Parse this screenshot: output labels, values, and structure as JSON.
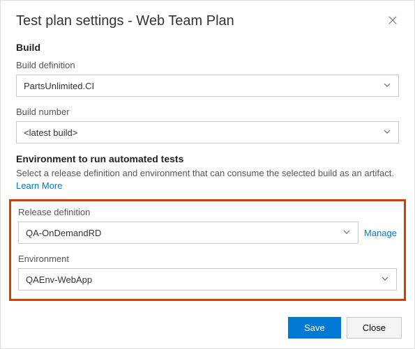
{
  "dialog": {
    "title": "Test plan settings - Web Team Plan"
  },
  "build": {
    "heading": "Build",
    "definition_label": "Build definition",
    "definition_value": "PartsUnlimited.CI",
    "number_label": "Build number",
    "number_value": "<latest build>"
  },
  "env": {
    "heading": "Environment to run automated tests",
    "description": "Select a release definition and environment that can consume the selected build as an artifact. ",
    "learn_more": "Learn More",
    "release_label": "Release definition",
    "release_value": "QA-OnDemandRD",
    "manage_label": "Manage",
    "environment_label": "Environment",
    "environment_value": "QAEnv-WebApp"
  },
  "footer": {
    "save": "Save",
    "close": "Close"
  }
}
